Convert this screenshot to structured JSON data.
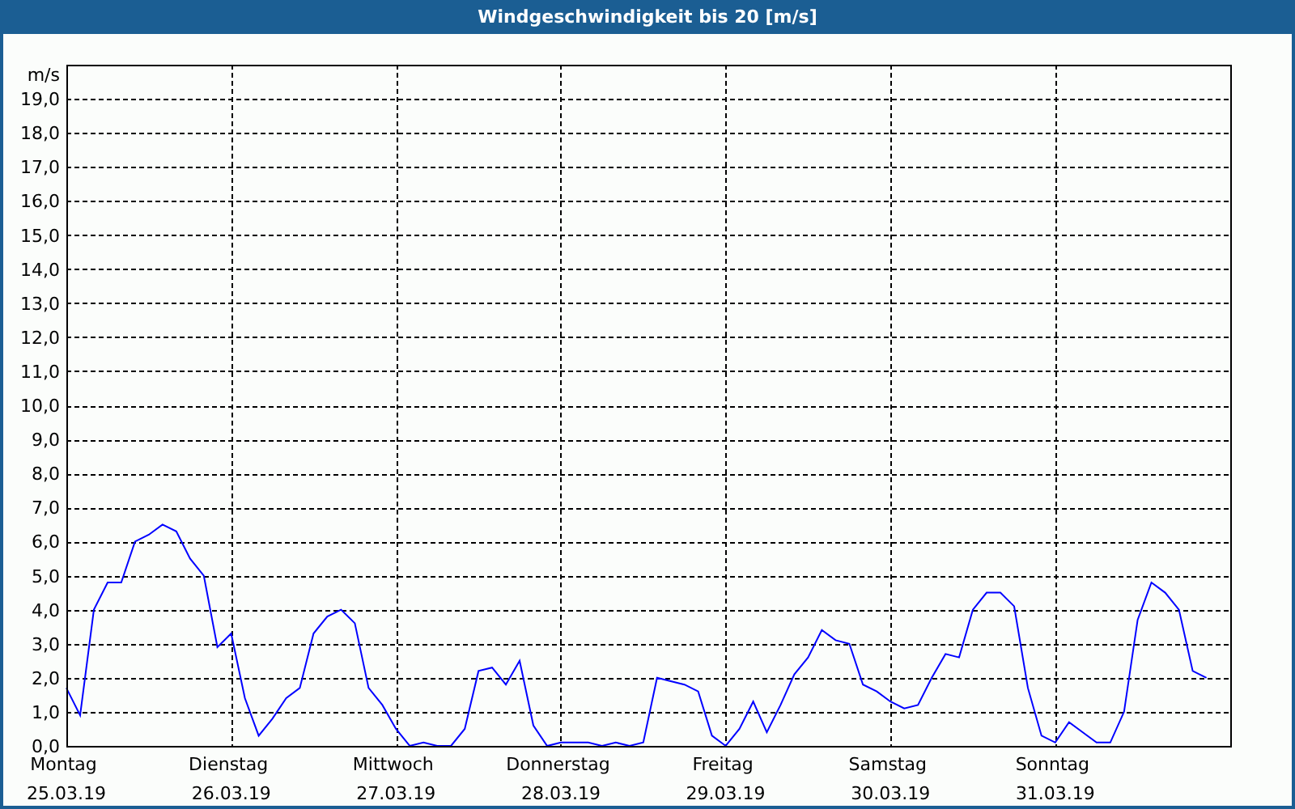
{
  "window": {
    "title": "Windgeschwindigkeit bis 20 [m/s]"
  },
  "chart": {
    "chart_data": {
      "type": "line",
      "grid": true,
      "ylabel": "m/s",
      "ylim": [
        0,
        20
      ],
      "categories": [
        "Montag 25.03.19",
        null,
        null,
        null,
        null,
        null,
        null,
        null,
        null,
        null,
        null,
        null,
        "Dienstag 26.03.19",
        null,
        null,
        null,
        null,
        null,
        null,
        null,
        null,
        null,
        null,
        null,
        "Mittwoch 27.03.19",
        null,
        null,
        null,
        null,
        null,
        null,
        null,
        null,
        null,
        null,
        null,
        "Donnerstag 28.03.19",
        null,
        null,
        null,
        null,
        null,
        null,
        null,
        null,
        null,
        null,
        null,
        "Freitag 29.03.19",
        null,
        null,
        null,
        null,
        null,
        null,
        null,
        null,
        null,
        null,
        null,
        "Samstag 30.03.19",
        null,
        null,
        null,
        null,
        null,
        null,
        null,
        null,
        null,
        null,
        null,
        "Sonntag 31.03.19",
        null,
        null,
        null,
        null,
        null,
        null,
        null,
        null,
        null,
        null,
        null
      ],
      "series": [
        {
          "color": "#0000ff",
          "values": [
            1.7,
            0.9,
            4.0,
            4.8,
            4.8,
            6.0,
            6.2,
            6.5,
            6.3,
            5.5,
            5.0,
            2.9,
            3.3,
            1.4,
            0.3,
            0.8,
            1.4,
            1.7,
            3.3,
            3.8,
            4.0,
            3.6,
            1.7,
            1.2,
            0.5,
            0.0,
            0.1,
            0.0,
            0.0,
            0.5,
            2.2,
            2.3,
            1.8,
            2.5,
            0.6,
            0.0,
            0.1,
            0.1,
            0.1,
            0.0,
            0.1,
            0.0,
            0.1,
            2.0,
            1.9,
            1.8,
            1.6,
            0.3,
            0.0,
            0.5,
            1.3,
            0.4,
            1.2,
            2.1,
            2.6,
            3.4,
            3.1,
            3.0,
            1.8,
            1.6,
            1.3,
            1.1,
            1.2,
            2.0,
            2.7,
            2.6,
            4.0,
            4.5,
            4.5,
            4.1,
            1.7,
            0.3,
            0.1,
            0.7,
            0.4,
            0.1,
            0.1,
            1.0,
            3.7,
            4.8,
            4.5,
            4.0,
            2.2,
            2.0
          ]
        }
      ],
      "yticks": [
        {
          "value": 0,
          "label": "0,0"
        },
        {
          "value": 1,
          "label": "1,0"
        },
        {
          "value": 2,
          "label": "2,0"
        },
        {
          "value": 3,
          "label": "3,0"
        },
        {
          "value": 4,
          "label": "4,0"
        },
        {
          "value": 5,
          "label": "5,0"
        },
        {
          "value": 6,
          "label": "6,0"
        },
        {
          "value": 7,
          "label": "7,0"
        },
        {
          "value": 8,
          "label": "8,0"
        },
        {
          "value": 9,
          "label": "9,0"
        },
        {
          "value": 10,
          "label": "10,0"
        },
        {
          "value": 11,
          "label": "11,0"
        },
        {
          "value": 12,
          "label": "12,0"
        },
        {
          "value": 13,
          "label": "13,0"
        },
        {
          "value": 14,
          "label": "14,0"
        },
        {
          "value": 15,
          "label": "15,0"
        },
        {
          "value": 16,
          "label": "16,0"
        },
        {
          "value": 17,
          "label": "17,0"
        },
        {
          "value": 18,
          "label": "18,0"
        },
        {
          "value": 19,
          "label": "19,0"
        }
      ]
    }
  }
}
